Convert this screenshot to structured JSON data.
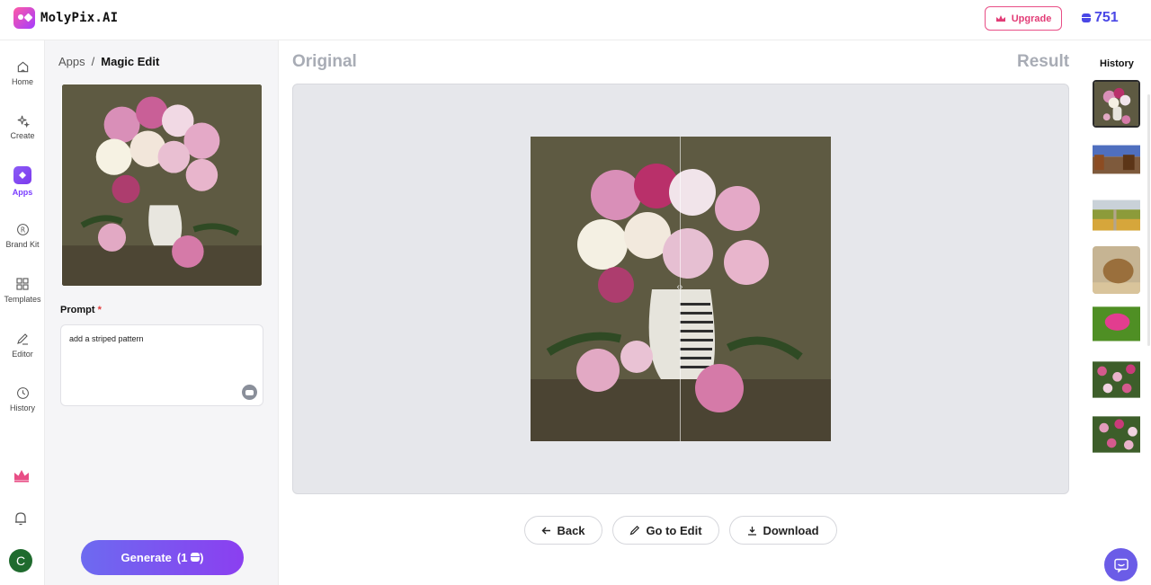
{
  "app": {
    "name": "MolyPix.AI"
  },
  "header": {
    "upgrade_label": "Upgrade",
    "credits": "751"
  },
  "nav": {
    "items": [
      {
        "label": "Home",
        "icon": "home-icon"
      },
      {
        "label": "Create",
        "icon": "sparkle-icon"
      },
      {
        "label": "Apps",
        "icon": "apps-icon",
        "active": true
      },
      {
        "label": "Brand Kit",
        "icon": "brand-kit-icon"
      },
      {
        "label": "Templates",
        "icon": "templates-icon"
      },
      {
        "label": "Editor",
        "icon": "pencil-icon"
      },
      {
        "label": "History",
        "icon": "clock-icon"
      }
    ],
    "avatar_initial": "C"
  },
  "breadcrumb": {
    "parent": "Apps",
    "separator": "/",
    "current": "Magic Edit"
  },
  "prompt": {
    "label": "Prompt",
    "required_mark": "*",
    "value": "add a striped pattern"
  },
  "generate": {
    "label": "Generate",
    "cost": "(1",
    "cost_suffix": ")"
  },
  "main": {
    "original_label": "Original",
    "result_label": "Result"
  },
  "actions": {
    "back": "Back",
    "go_to_edit": "Go to Edit",
    "download": "Download"
  },
  "history": {
    "title": "History",
    "thumbnails": [
      "peonies-vase",
      "horses",
      "field-trees",
      "hay-bale",
      "pink-flower",
      "pink-wildflowers-1",
      "pink-wildflowers-2"
    ]
  },
  "colors": {
    "accent": "#7a3cff",
    "brand_pink": "#e23c76",
    "credit_blue": "#4a47e6"
  }
}
